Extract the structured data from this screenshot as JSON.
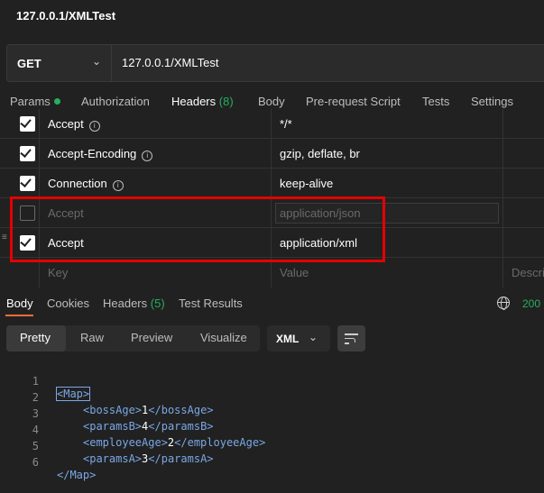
{
  "window": {
    "title": "127.0.0.1/XMLTest"
  },
  "request": {
    "method": "GET",
    "url": "127.0.0.1/XMLTest"
  },
  "request_tabs": [
    {
      "label": "Params"
    },
    {
      "label": "Authorization"
    },
    {
      "label": "Headers",
      "count": "(8)"
    },
    {
      "label": "Body"
    },
    {
      "label": "Pre-request Script"
    },
    {
      "label": "Tests"
    },
    {
      "label": "Settings"
    }
  ],
  "headers": {
    "rows": [
      {
        "key": "Accept",
        "value": "*/*"
      },
      {
        "key": "Accept-Encoding",
        "value": "gzip, deflate, br"
      },
      {
        "key": "Connection",
        "value": "keep-alive"
      },
      {
        "key": "Accept",
        "value": "application/json"
      },
      {
        "key": "Accept",
        "value": "application/xml"
      }
    ],
    "key_placeholder": "Key",
    "value_placeholder": "Value",
    "desc_placeholder": "Descri",
    "info_glyph": "i"
  },
  "response_tabs": [
    {
      "label": "Body"
    },
    {
      "label": "Cookies"
    },
    {
      "label": "Headers",
      "count": "(5)"
    },
    {
      "label": "Test Results"
    }
  ],
  "response": {
    "status": "200",
    "views": [
      "Pretty",
      "Raw",
      "Preview",
      "Visualize"
    ],
    "format": "XML"
  },
  "code": {
    "lines": [
      {
        "n": "1",
        "text": "<Map>"
      },
      {
        "n": "2",
        "text": "<bossAge>1</bossAge>"
      },
      {
        "n": "3",
        "text": "<paramsB>4</paramsB>"
      },
      {
        "n": "4",
        "text": "<employeeAge>2</employeeAge>"
      },
      {
        "n": "5",
        "text": "<paramsA>3</paramsA>"
      },
      {
        "n": "6",
        "text": "</Map>"
      }
    ]
  },
  "colors": {
    "accent": "#ff6c37",
    "success": "#27ae60",
    "highlight_box": "#e40000",
    "xml_tag": "#7aa7e6"
  }
}
